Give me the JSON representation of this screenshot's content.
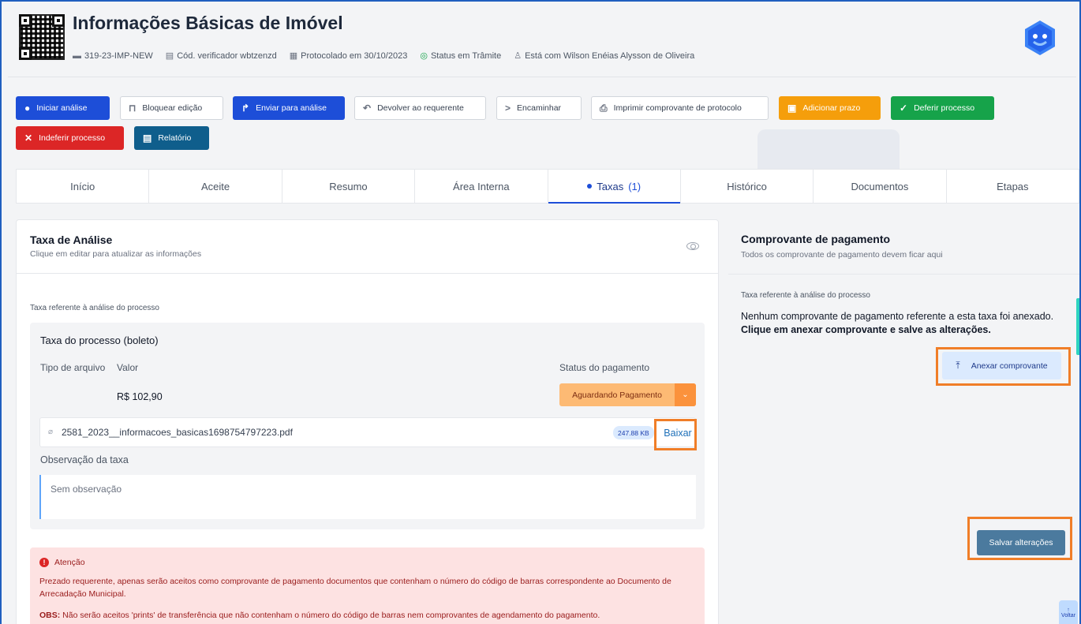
{
  "header": {
    "title": "Informações Básicas de Imóvel",
    "meta": [
      {
        "icon": "briefcase-icon",
        "text": "319-23-IMP-NEW"
      },
      {
        "icon": "document-icon",
        "text": "Cód. verificador wbtzenzd"
      },
      {
        "icon": "calendar-icon",
        "text": "Protocolado em 30/10/2023"
      },
      {
        "icon": "check-circle-icon",
        "text": "Status em Trâmite"
      },
      {
        "icon": "user-icon",
        "text": "Está com Wilson Enéias Alysson de Oliveira"
      }
    ]
  },
  "toolbar": {
    "iniciar": "Iniciar análise",
    "bloquear": "Bloquear edição",
    "enviar": "Enviar para análise",
    "devolver": "Devolver ao requerente",
    "encaminhar": "Encaminhar",
    "imprimir": "Imprimir comprovante de protocolo",
    "adicionar_prazo": "Adicionar prazo",
    "deferir": "Deferir processo",
    "indeferir": "Indeferir processo",
    "relatorio": "Relatório"
  },
  "tabs": [
    {
      "label": "Início"
    },
    {
      "label": "Aceite"
    },
    {
      "label": "Resumo"
    },
    {
      "label": "Área Interna"
    },
    {
      "label": "Taxas",
      "count": "(1)",
      "active": true
    },
    {
      "label": "Histórico"
    },
    {
      "label": "Documentos"
    },
    {
      "label": "Etapas"
    }
  ],
  "taxa": {
    "title": "Taxa de Análise",
    "subtitle": "Clique em editar para atualizar as informações",
    "ref": "Taxa referente à análise do processo",
    "box_title": "Taxa do processo (boleto)",
    "tipo_label": "Tipo de arquivo",
    "valor_label": "Valor",
    "status_label": "Status do pagamento",
    "amount": "R$ 102,90",
    "status_value": "Aguardando Pagamento",
    "file_name": "2581_2023__informacoes_basicas1698754797223.pdf",
    "file_size": "247.88 KB",
    "download_label": "Baixar",
    "obs_label": "Observação da taxa",
    "obs_value": "Sem observação"
  },
  "alert": {
    "title": "Atenção",
    "text": "Prezado requerente, apenas serão aceitos como comprovante de pagamento documentos que contenham o número do código de barras correspondente ao Documento de Arrecadação Municipal.",
    "obs_prefix": "OBS:",
    "obs_text": " Não serão aceitos 'prints' de transferência que não contenham o número do código de barras nem comprovantes de agendamento do pagamento."
  },
  "comprovante": {
    "title": "Comprovante de pagamento",
    "subtitle": "Todos os comprovante de pagamento devem ficar aqui",
    "ref": "Taxa referente à análise do processo",
    "msg": "Nenhum comprovante de pagamento referente a esta taxa foi anexado.",
    "msg_bold": "Clique em anexar comprovante e salve as alterações.",
    "anexar_label": "Anexar comprovante",
    "salvar_label": "Salvar alterações"
  },
  "voltar_label": "Voltar",
  "colors": {
    "primary": "#1d4ed8",
    "highlight": "#f07e28",
    "warning": "#fdba74",
    "danger": "#dc2626",
    "success": "#16a34a"
  }
}
